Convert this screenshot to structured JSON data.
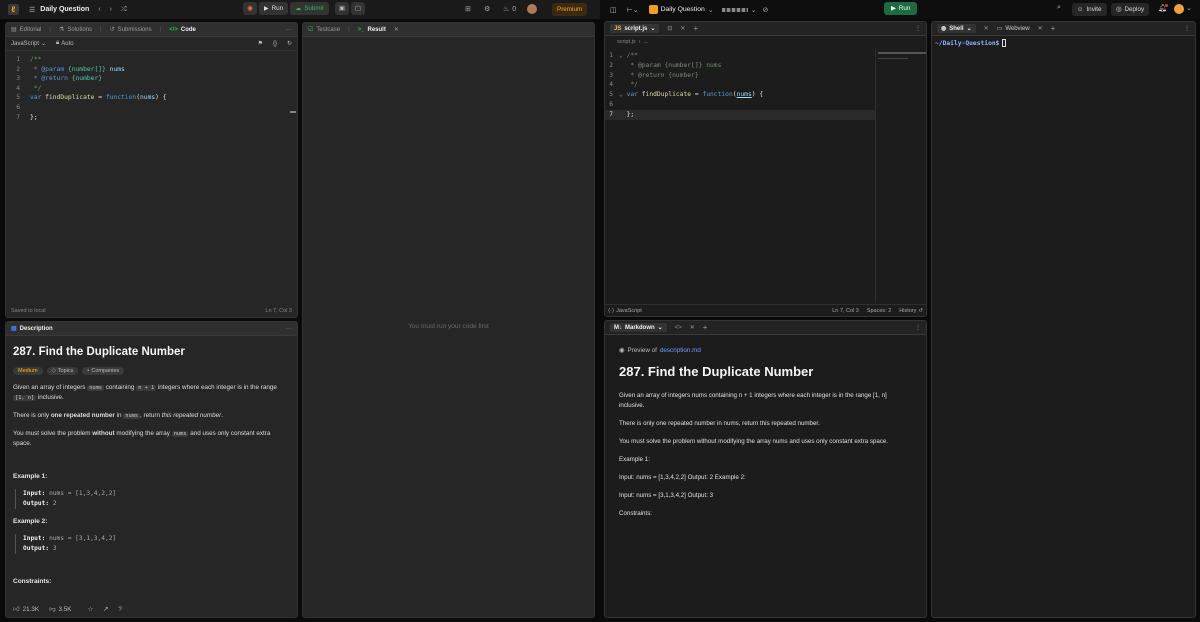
{
  "topbar": {
    "title": "Daily Question",
    "run": "Run",
    "submit": "Submit",
    "streak_count": "0",
    "premium": "Premium"
  },
  "replit": {
    "title": "Daily Question",
    "run": "Run",
    "invite": "Invite",
    "deploy": "Deploy"
  },
  "left_tabs": [
    "Editorial",
    "Solutions",
    "Submissions",
    "Code"
  ],
  "editor": {
    "language": "JavaScript",
    "auto": "Auto",
    "lines": [
      "1",
      "2",
      "3",
      "4",
      "5",
      "6",
      "7"
    ],
    "status_left": "Saved to local",
    "status_right": "Ln 7, Col 3"
  },
  "result_tabs": [
    "Testcase",
    "Result"
  ],
  "result_placeholder": "You must run your code first",
  "description": {
    "tab": "Description",
    "title": "287. Find the Duplicate Number",
    "difficulty": "Medium",
    "topics": "Topics",
    "companies": "Companies",
    "p1_a": "Given an array of integers",
    "p1_code1": "nums",
    "p1_b": "containing",
    "p1_code2": "n + 1",
    "p1_c": "integers where each integer is in the range",
    "p1_code3": "[1, n]",
    "p1_d": "inclusive.",
    "p2_a": "There is only",
    "p2_bold": "one repeated number",
    "p2_b": "in",
    "p2_code": "nums",
    "p2_c": ", return",
    "p2_italic": "this repeated number",
    "p2_d": ".",
    "p3_a": "You must solve the problem",
    "p3_bold": "without",
    "p3_b": "modifying the array",
    "p3_code": "nums",
    "p3_c": "and uses only constant extra space.",
    "ex1_title": "Example 1:",
    "ex1_input_label": "Input:",
    "ex1_input": "nums = [1,3,4,2,2]",
    "ex1_output_label": "Output:",
    "ex1_output": "2",
    "ex2_title": "Example 2:",
    "ex2_input_label": "Input:",
    "ex2_input": "nums = [3,1,3,4,2]",
    "ex2_output_label": "Output:",
    "ex2_output": "3",
    "constraints": "Constraints:",
    "likes": "21.3K",
    "dislikes": "3.5K"
  },
  "script_editor": {
    "tab": "script.js",
    "breadcrumb_file": "script.js",
    "breadcrumb_more": "...",
    "status_lang": "JavaScript",
    "status_pos": "Ln 7, Col 3",
    "status_spaces": "Spaces: 2",
    "status_history": "History"
  },
  "markdown": {
    "tab": "Markdown",
    "preview_label": "Preview of",
    "preview_file": "description.md",
    "title": "287. Find the Duplicate Number",
    "p1": "Given an array of integers nums containing n + 1 integers where each integer is in the range [1, n] inclusive.",
    "p2": "There is only one repeated number in nums, return this repeated number.",
    "p3": "You must solve the problem without modifying the array nums and uses only constant extra space.",
    "p4": "Example 1:",
    "p5": "Input: nums = [1,3,4,2,2] Output: 2 Example 2:",
    "p6": "Input: nums = [3,1,3,4,2] Output: 3",
    "p7": "Constraints:"
  },
  "shell": {
    "tab_shell": "Shell",
    "tab_webview": "Webview",
    "prompt": "~/Daily-Question$"
  },
  "colors": {
    "run_green": "#1e6b41",
    "submit_green": "#2cbb5d",
    "premium_orange": "#ffa116",
    "medium_yellow": "#ffb800",
    "link_blue": "#3d8bfd"
  }
}
